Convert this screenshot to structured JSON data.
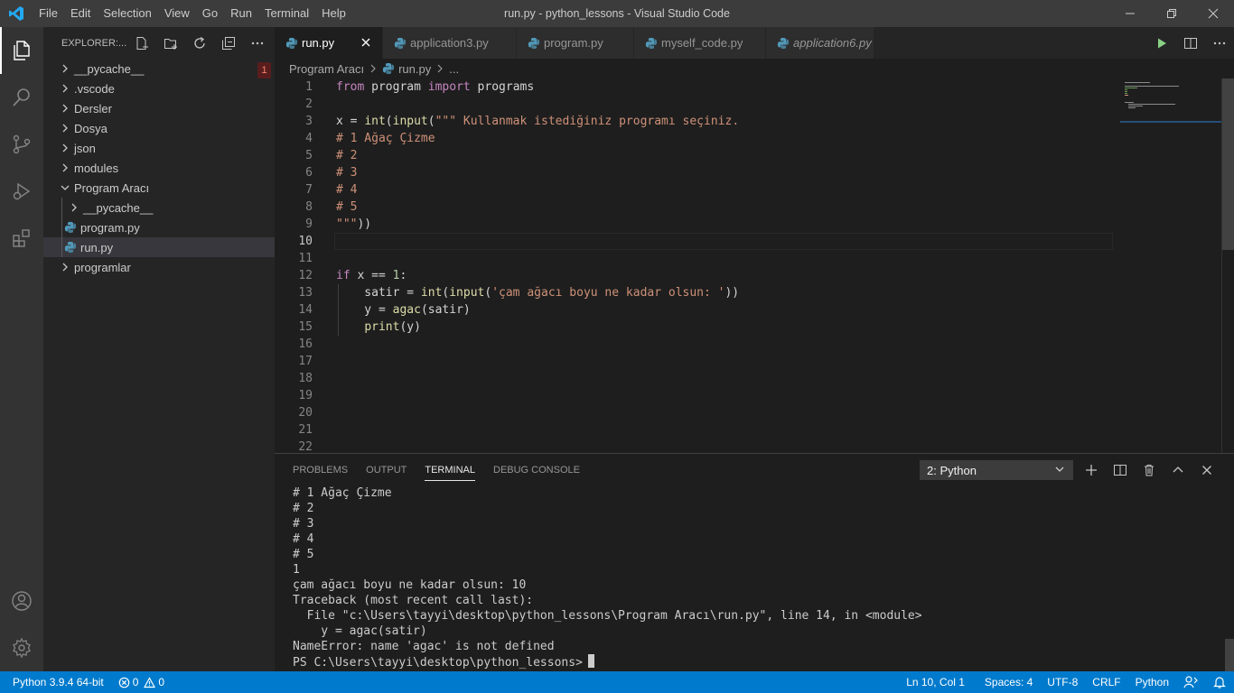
{
  "titlebar": {
    "menu": [
      "File",
      "Edit",
      "Selection",
      "View",
      "Go",
      "Run",
      "Terminal",
      "Help"
    ],
    "title": "run.py - python_lessons - Visual Studio Code"
  },
  "activity": [
    "explorer-icon",
    "search-icon",
    "source-control-icon",
    "run-debug-icon",
    "extensions-icon",
    "account-icon",
    "settings-gear-icon"
  ],
  "sidebar": {
    "header": "EXPLORER:...",
    "tree": [
      {
        "label": "__pycache__",
        "type": "folder",
        "level": 0,
        "badge": "1"
      },
      {
        "label": ".vscode",
        "type": "folder",
        "level": 0
      },
      {
        "label": "Dersler",
        "type": "folder",
        "level": 0
      },
      {
        "label": "Dosya",
        "type": "folder",
        "level": 0
      },
      {
        "label": "json",
        "type": "folder",
        "level": 0
      },
      {
        "label": "modules",
        "type": "folder",
        "level": 0
      },
      {
        "label": "Program Aracı",
        "type": "folder-open",
        "level": 0
      },
      {
        "label": "__pycache__",
        "type": "folder",
        "level": 1
      },
      {
        "label": "program.py",
        "type": "file",
        "level": 1
      },
      {
        "label": "run.py",
        "type": "file",
        "level": 1,
        "selected": true
      },
      {
        "label": "programlar",
        "type": "folder",
        "level": 0
      }
    ]
  },
  "tabs": [
    {
      "label": "run.py",
      "active": true
    },
    {
      "label": "application3.py"
    },
    {
      "label": "program.py"
    },
    {
      "label": "myself_code.py"
    },
    {
      "label": "application6.py",
      "italic": true
    }
  ],
  "breadcrumb": {
    "folder": "Program Aracı",
    "file": "run.py",
    "more": "..."
  },
  "code": [
    "from program import programs",
    "",
    "x = int(input(\"\"\" Kullanmak istediğiniz programı seçiniz.",
    "# 1 Ağaç Çizme",
    "# 2",
    "# 3",
    "# 4",
    "# 5",
    "\"\"\"))",
    "",
    "",
    "if x == 1:",
    "    satir = int(input('çam ağacı boyu ne kadar olsun: '))",
    "    y = agac(satir)",
    "    print(y)",
    "",
    "",
    "",
    "",
    "",
    "",
    ""
  ],
  "current_line": 10,
  "panel": {
    "tabs": [
      "PROBLEMS",
      "OUTPUT",
      "TERMINAL",
      "DEBUG CONSOLE"
    ],
    "active_tab": "TERMINAL",
    "terminal_select": "2: Python",
    "terminal_lines": [
      "# 1 Ağaç Çizme",
      "# 2",
      "# 3",
      "# 4",
      "# 5",
      "1",
      "çam ağacı boyu ne kadar olsun: 10",
      "Traceback (most recent call last):",
      "  File \"c:\\Users\\tayyi\\desktop\\python_lessons\\Program Aracı\\run.py\", line 14, in <module>",
      "    y = agac(satir)",
      "NameError: name 'agac' is not defined",
      "PS C:\\Users\\tayyi\\desktop\\python_lessons>"
    ]
  },
  "statusbar": {
    "interpreter": "Python 3.9.4 64-bit",
    "errors": "0",
    "warnings": "0",
    "position": "Ln 10, Col 1",
    "spaces": "Spaces: 4",
    "encoding": "UTF-8",
    "eol": "CRLF",
    "language": "Python"
  },
  "colors": {
    "accent": "#007acc",
    "titlebar": "#3c3c3c",
    "sidebar": "#252526",
    "editor": "#1e1e1e",
    "python_icon": "#519aba"
  }
}
